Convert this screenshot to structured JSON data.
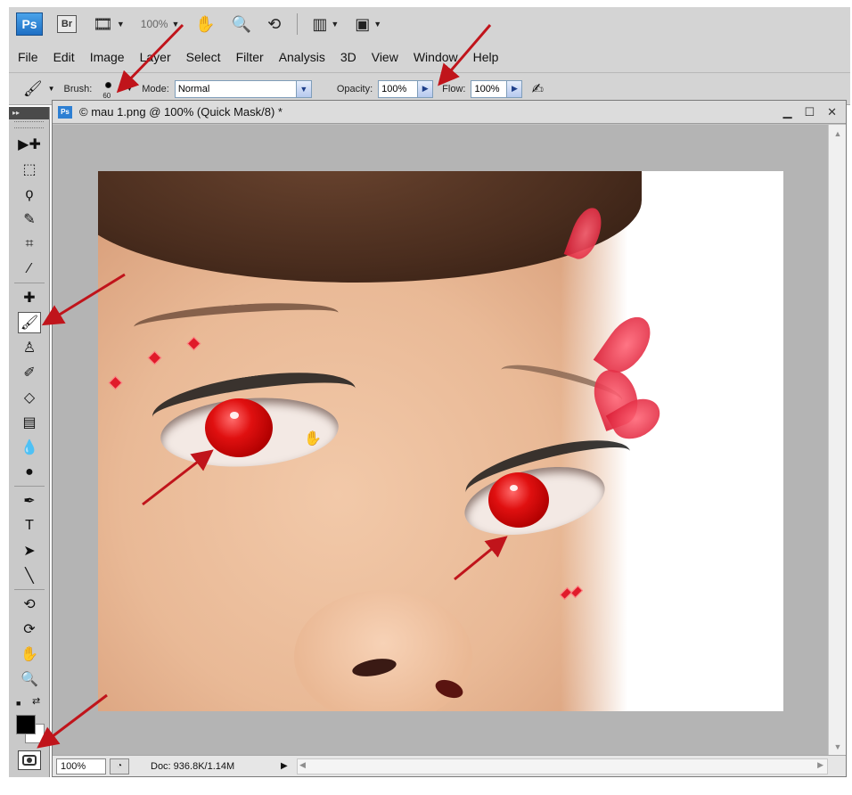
{
  "appbar": {
    "ps_logo": "Ps",
    "bridge_logo": "Br",
    "zoom_level": "100%"
  },
  "menu": [
    "File",
    "Edit",
    "Image",
    "Layer",
    "Select",
    "Filter",
    "Analysis",
    "3D",
    "View",
    "Window",
    "Help"
  ],
  "options": {
    "brush_label": "Brush:",
    "brush_size": "60",
    "mode_label": "Mode:",
    "mode_value": "Normal",
    "opacity_label": "Opacity:",
    "opacity_value": "100%",
    "flow_label": "Flow:",
    "flow_value": "100%"
  },
  "document": {
    "ps_icon": "Ps",
    "title": "© mau 1.png @ 100% (Quick Mask/8) *",
    "status_zoom": "100%",
    "status_doc": "Doc: 936.8K/1.14M"
  },
  "tools": [
    {
      "name": "move-tool-icon",
      "glyph": "▶✚"
    },
    {
      "name": "marquee-tool-icon",
      "glyph": "⬚"
    },
    {
      "name": "lasso-tool-icon",
      "glyph": "ϙ"
    },
    {
      "name": "quick-selection-tool-icon",
      "glyph": "✎"
    },
    {
      "name": "crop-tool-icon",
      "glyph": "⌗"
    },
    {
      "name": "eyedropper-tool-icon",
      "glyph": "⁄"
    },
    {
      "name": "healing-brush-tool-icon",
      "glyph": "✚"
    },
    {
      "name": "brush-tool-icon",
      "glyph": "🖌"
    },
    {
      "name": "clone-stamp-tool-icon",
      "glyph": "♙"
    },
    {
      "name": "history-brush-tool-icon",
      "glyph": "✐"
    },
    {
      "name": "eraser-tool-icon",
      "glyph": "◇"
    },
    {
      "name": "gradient-tool-icon",
      "glyph": "▤"
    },
    {
      "name": "blur-tool-icon",
      "glyph": "💧"
    },
    {
      "name": "dodge-tool-icon",
      "glyph": "●"
    },
    {
      "name": "pen-tool-icon",
      "glyph": "✒"
    },
    {
      "name": "type-tool-icon",
      "glyph": "T"
    },
    {
      "name": "path-selection-tool-icon",
      "glyph": "➤"
    },
    {
      "name": "line-tool-icon",
      "glyph": "╲"
    },
    {
      "name": "3d-rotate-tool-icon",
      "glyph": "⟲"
    },
    {
      "name": "3d-orbit-tool-icon",
      "glyph": "⟳"
    },
    {
      "name": "hand-tool-icon",
      "glyph": "✋"
    },
    {
      "name": "zoom-tool-icon",
      "glyph": "🔍"
    }
  ],
  "colors": {
    "foreground": "#000000",
    "background": "#ffffff",
    "annotation_arrow": "#c0141b"
  }
}
